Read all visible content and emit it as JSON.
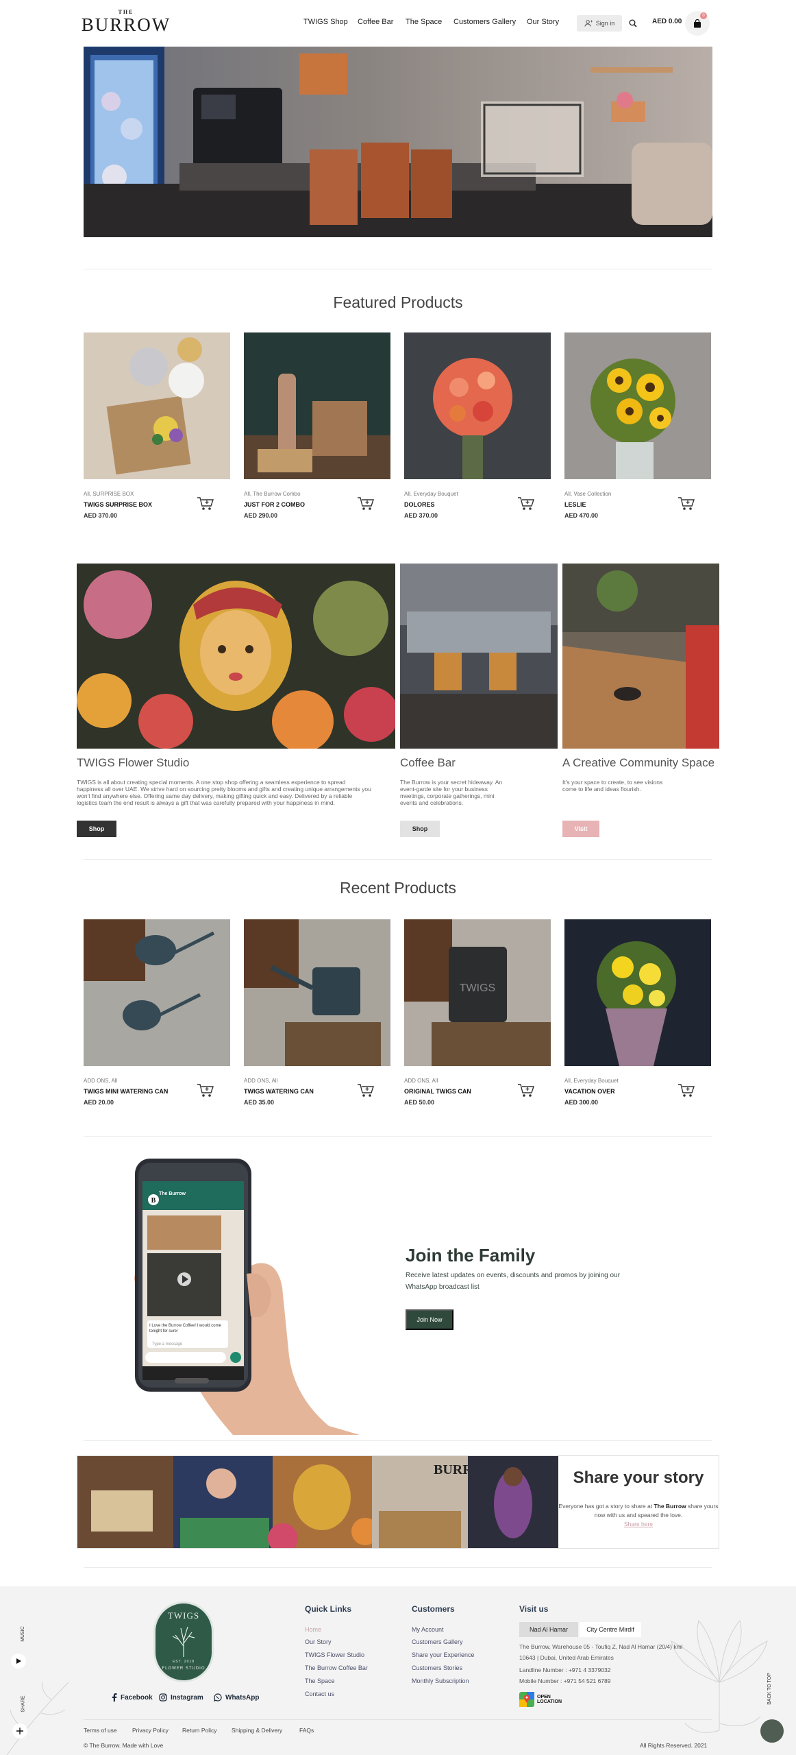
{
  "header": {
    "logo_the": "THE",
    "logo_name": "BURROW",
    "nav": [
      "TWIGS Shop",
      "Coffee Bar",
      "The Space",
      "Customers Gallery",
      "Our Story"
    ],
    "sign_in": "Sign in",
    "cart_total": "AED 0.00",
    "cart_count": "0"
  },
  "featured": {
    "title": "Featured Products",
    "products": [
      {
        "category": "All, SURPRISE BOX",
        "name": "TWIGS SURPRISE BOX",
        "price": "AED 370.00"
      },
      {
        "category": "All, The Burrow Combo",
        "name": "JUST FOR 2 COMBO",
        "price": "AED 290.00"
      },
      {
        "category": "All, Everyday Bouquet",
        "name": "DOLORES",
        "price": "AED 370.00"
      },
      {
        "category": "All, Vase Collection",
        "name": "LESLIE",
        "price": "AED 470.00"
      }
    ]
  },
  "categories": [
    {
      "title": "TWIGS Flower Studio",
      "desc": "TWIGS is all about creating special moments. A one stop shop offering a seamless experience to spread happiness all over UAE. We strive hard on sourcing pretty blooms and gifts and creating unique arrangements you won't find anywhere else. Offering same day delivery, making gifting quick and easy. Delivered by a reliable logistics team the end result is always a gift that was carefully prepared with your happiness in mind.",
      "button": "Shop"
    },
    {
      "title": "Coffee Bar",
      "desc": "The Burrow is your secret hideaway. An event-garde site for your business meetings, corporate gatherings, mini events and celebrations.",
      "button": "Shop"
    },
    {
      "title": "A Creative Community Space",
      "desc": "It's your space to create, to see visions come to life and ideas flourish.",
      "button": "Visit"
    }
  ],
  "recent": {
    "title": "Recent Products",
    "products": [
      {
        "category": "ADD ONS, All",
        "name": "TWIGS MINI WATERING CAN",
        "price": "AED 20.00"
      },
      {
        "category": "ADD ONS, All",
        "name": "TWIGS WATERING CAN",
        "price": "AED 35.00"
      },
      {
        "category": "ADD ONS, All",
        "name": "ORIGINAL TWIGS CAN",
        "price": "AED 50.00"
      },
      {
        "category": "All, Everyday Bouquet",
        "name": "VACATION OVER",
        "price": "AED 300.00"
      }
    ]
  },
  "join": {
    "title": "Join the Family",
    "text": "Receive latest updates on events, discounts and promos by joining our WhatsApp broadcast list",
    "button": "Join Now",
    "phone_chat_name": "The Burrow",
    "phone_chat_msg": "I Love the Burrow Coffee! I would come tonight for sure!",
    "phone_input": "Type a message"
  },
  "story": {
    "title": "Share your story",
    "text_prefix": "Everyone has got a story to share at ",
    "text_brand": "The Burrow",
    "text_suffix": "share yours now with us and speared the love.",
    "link": "Share here"
  },
  "footer": {
    "badge_top": "TWIGS",
    "badge_mid": "EST. 2018",
    "badge_bottom": "FLOWER STUDIO",
    "social": [
      "Facebook",
      "Instagram",
      "WhatsApp"
    ],
    "quick_links_title": "Quick Links",
    "quick_links": [
      "Home",
      "Our Story",
      "TWIGS Flower Studio",
      "The Burrow Coffee Bar",
      "The Space",
      "Contact us"
    ],
    "customers_title": "Customers",
    "customers_links": [
      "My Account",
      "Customers Gallery",
      "Share your Experience",
      "Customers Stories",
      "Monthly Subscription"
    ],
    "visit_title": "Visit us",
    "tabs": [
      "Nad Al Hamar",
      "City Centre Mirdif"
    ],
    "address": "The Burrow, Warehouse 05 - Toufiq Z, Nad Al Hamar (20/4) kml 10643 | Dubai, United Arab Emirates",
    "landline": "Landline Number : +971 4 3379032",
    "mobile": "Mobile Number : +971 54 521 6789",
    "open_location": "OPEN LOCATION",
    "bottom_links": [
      "Terms of use",
      "Privacy Policy",
      "Return Policy",
      "Shipping & Delivery",
      "FAQs"
    ],
    "made_with": "© The Burrow. Made with Love",
    "rights": "All Rights Reserved. 2021",
    "music": "MUSIC",
    "share": "SHARE",
    "back_to_top": "BACK TO TOP"
  },
  "colors": {
    "accent_green": "#2f4a3d",
    "visit_pink": "#e7b3b5",
    "footer_bg": "#f3f3f3",
    "badge_green": "#2f5a48"
  }
}
